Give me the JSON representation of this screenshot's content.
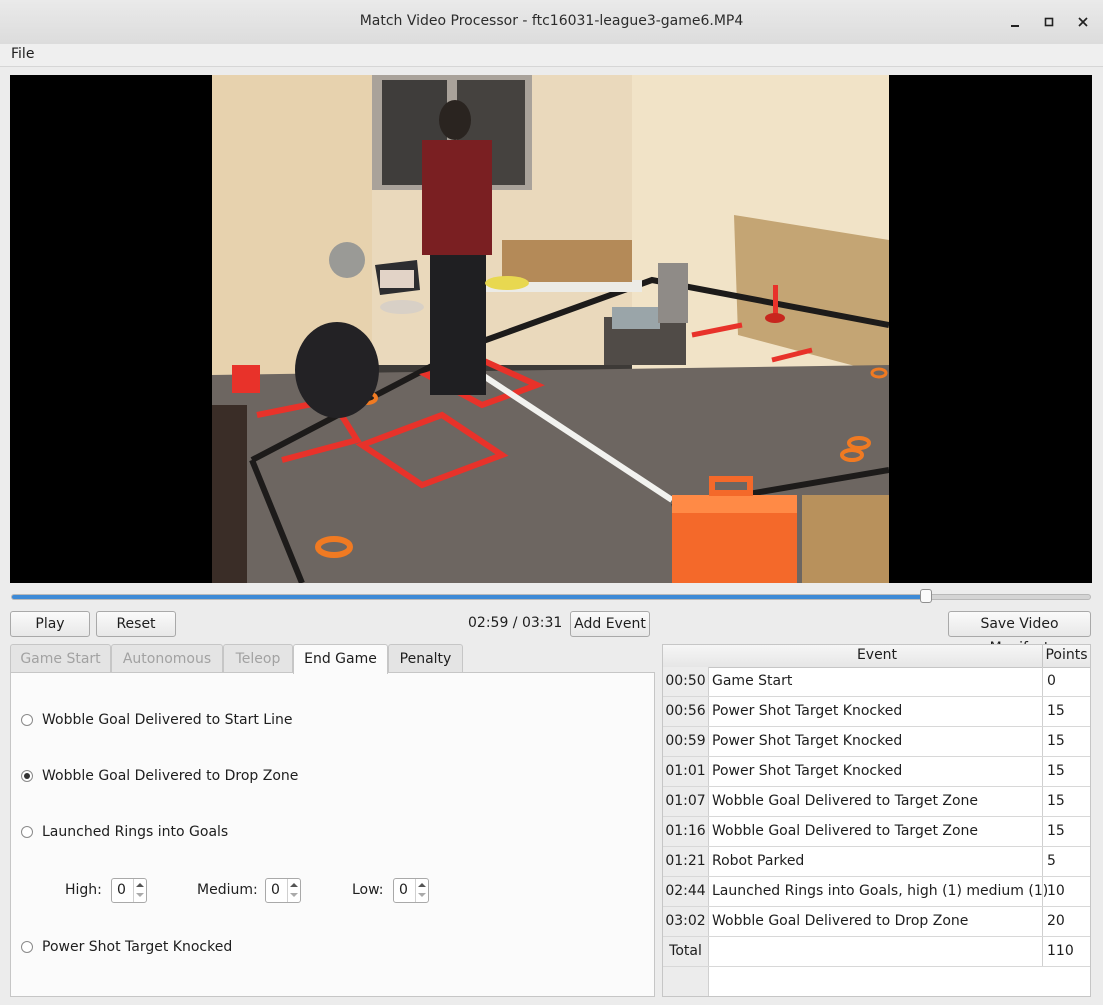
{
  "window": {
    "title": "Match Video Processor - ftc16031-league3-game6.MP4",
    "minimize_glyph": "🗕",
    "maximize_glyph": "🗖",
    "close_glyph": "✕"
  },
  "menu": {
    "file": "File"
  },
  "playback": {
    "progress_fraction": 0.8483,
    "play_label": "Play",
    "reset_label": "Reset",
    "timecode": "02:59 / 03:31",
    "add_event_label": "Add Event",
    "save_manifest_label": "Save Video Manifest"
  },
  "tabs": [
    {
      "label": "Game Start",
      "state": "disabled"
    },
    {
      "label": "Autonomous",
      "state": "disabled"
    },
    {
      "label": "Teleop",
      "state": "disabled"
    },
    {
      "label": "End Game",
      "state": "active"
    },
    {
      "label": "Penalty",
      "state": "enabled"
    }
  ],
  "endgame": {
    "options": [
      {
        "label": "Wobble Goal Delivered to Start Line",
        "checked": false
      },
      {
        "label": "Wobble Goal Delivered to Drop Zone",
        "checked": true
      },
      {
        "label": "Launched Rings into Goals",
        "checked": false
      },
      {
        "label": "Power Shot Target Knocked",
        "checked": false
      }
    ],
    "high_label": "High:",
    "high_value": "0",
    "medium_label": "Medium:",
    "medium_value": "0",
    "low_label": "Low:",
    "low_value": "0"
  },
  "events_table": {
    "col_event": "Event",
    "col_points": "Points",
    "rows": [
      {
        "time": "00:50",
        "event": "Game Start",
        "points": "0"
      },
      {
        "time": "00:56",
        "event": "Power Shot Target Knocked",
        "points": "15"
      },
      {
        "time": "00:59",
        "event": "Power Shot Target Knocked",
        "points": "15"
      },
      {
        "time": "01:01",
        "event": "Power Shot Target Knocked",
        "points": "15"
      },
      {
        "time": "01:07",
        "event": "Wobble Goal Delivered to Target Zone",
        "points": "15"
      },
      {
        "time": "01:16",
        "event": "Wobble Goal Delivered to Target Zone",
        "points": "15"
      },
      {
        "time": "01:21",
        "event": "Robot Parked",
        "points": "5"
      },
      {
        "time": "02:44",
        "event": "Launched Rings into Goals, high (1) medium (1)",
        "points": "10"
      },
      {
        "time": "03:02",
        "event": "Wobble Goal Delivered to Drop Zone",
        "points": "20"
      }
    ],
    "total_label": "Total",
    "total_points": "110"
  },
  "colors": {
    "accent": "#3d8ad6",
    "tape_red": "#e8322a",
    "ring_orange": "#f07a22"
  }
}
